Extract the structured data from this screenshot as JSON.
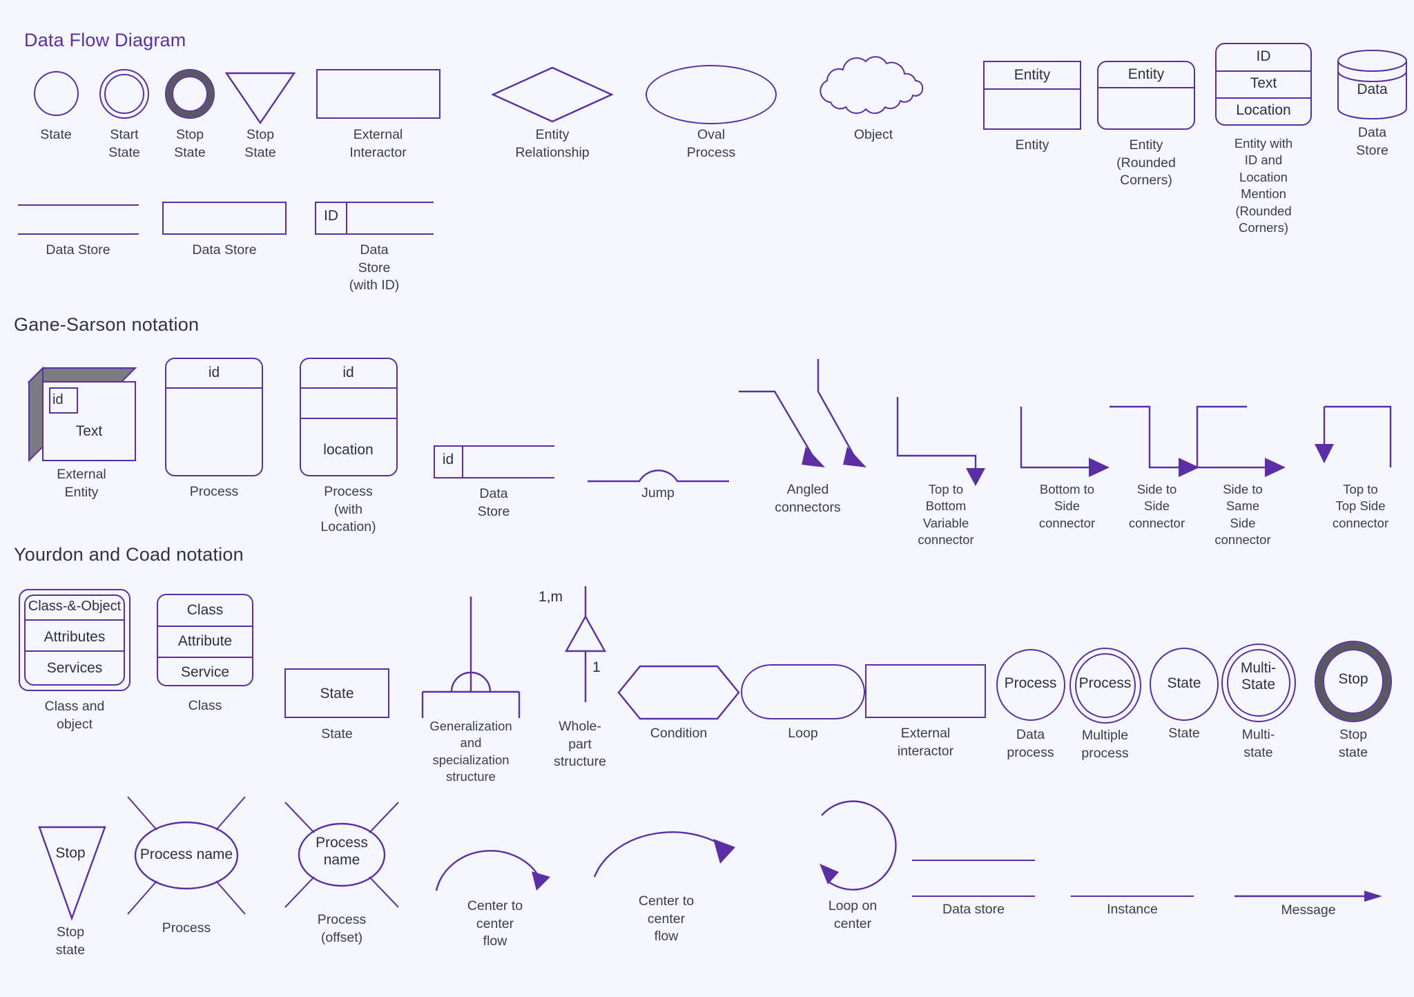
{
  "page": {
    "background": "#f4f8fe",
    "accent": "#5b2ea6",
    "ring_grey": "#58585f",
    "text_color": "#3c3c47"
  },
  "sections": [
    {
      "id": "dfd",
      "title": "Data Flow Diagram"
    },
    {
      "id": "gane",
      "title": "Gane-Sarson notation"
    },
    {
      "id": "yourdon",
      "title": "Yourdon and Coad notation"
    }
  ],
  "dfd": {
    "row1": [
      {
        "caption": "State",
        "shape": "circle"
      },
      {
        "caption": "Start State",
        "shape": "double-circle"
      },
      {
        "caption": "Stop State",
        "shape": "thick-ring-circle"
      },
      {
        "caption": "Stop State",
        "shape": "down-triangle"
      },
      {
        "caption": "External Interactor",
        "shape": "rectangle"
      },
      {
        "caption": "Entity Relationship",
        "shape": "diamond"
      },
      {
        "caption": "Oval Process",
        "shape": "oval"
      },
      {
        "caption": "Object",
        "shape": "cloud"
      },
      {
        "caption": "Entity",
        "shape": "entity-box",
        "cells": [
          "Entity"
        ]
      },
      {
        "caption": "Entity\n(Rounded Corners)",
        "shape": "entity-box-rounded",
        "cells": [
          "Entity"
        ]
      },
      {
        "caption": "Entity with ID and\nLocation Mention\n(Rounded Corners)",
        "shape": "entity-three-rounded",
        "cells": [
          "ID",
          "Text",
          "Location"
        ]
      },
      {
        "caption": "Data Store",
        "shape": "cylinder",
        "cells": [
          "Data"
        ]
      }
    ],
    "row2": [
      {
        "caption": "Data Store",
        "shape": "open-store"
      },
      {
        "caption": "Data Store",
        "shape": "closed-store"
      },
      {
        "caption": "Data Store (with ID)",
        "shape": "store-with-id",
        "cells": [
          "ID"
        ]
      }
    ]
  },
  "gane": {
    "items": [
      {
        "caption": "External Entity",
        "shape": "3d-box",
        "cells": [
          "id",
          "Text"
        ]
      },
      {
        "caption": "Process",
        "shape": "process-2",
        "cells": [
          "id"
        ]
      },
      {
        "caption": "Process\n(with Location)",
        "shape": "process-3",
        "cells": [
          "id",
          "",
          "location"
        ]
      },
      {
        "caption": "Data Store",
        "shape": "gane-store",
        "cells": [
          "id"
        ]
      },
      {
        "caption": "Jump",
        "shape": "jump"
      },
      {
        "caption": "Angled connectors",
        "shape": "angled-connectors"
      },
      {
        "caption": "Top to Bottom\nVariable\nconnector",
        "shape": "top-bottom-variable"
      },
      {
        "caption": "Bottom to Side\nconnector",
        "shape": "bottom-to-side"
      },
      {
        "caption": "Side to Side\nconnector",
        "shape": "side-to-side"
      },
      {
        "caption": "Side to Same\nSide connector",
        "shape": "side-to-same-side"
      },
      {
        "caption": "Top to Top Side\nconnector",
        "shape": "top-to-top-side"
      }
    ]
  },
  "yourdon": {
    "row1": [
      {
        "caption": "Class and object",
        "shape": "class-and-object",
        "cells": [
          "Class-&-Object",
          "Attributes",
          "Services"
        ]
      },
      {
        "caption": "Class",
        "shape": "class",
        "cells": [
          "Class",
          "Attribute",
          "Service"
        ]
      },
      {
        "caption": "State",
        "shape": "state-rect",
        "cells": [
          "State"
        ]
      },
      {
        "caption": "Generalization\nand specialization\nstructure",
        "shape": "generalization"
      },
      {
        "caption": "Whole-part\nstructure",
        "shape": "whole-part",
        "labels": [
          "1,m",
          "1"
        ]
      },
      {
        "caption": "Condition",
        "shape": "hexagon"
      },
      {
        "caption": "Loop",
        "shape": "loop-shape"
      },
      {
        "caption": "External\ninteractor",
        "shape": "rectangle"
      },
      {
        "caption": "Data process",
        "shape": "circle-label",
        "cells": [
          "Process"
        ]
      },
      {
        "caption": "Multiple\nprocess",
        "shape": "double-circle-label",
        "cells": [
          "Process"
        ]
      },
      {
        "caption": "State",
        "shape": "circle-label",
        "cells": [
          "State"
        ]
      },
      {
        "caption": "Multi-state",
        "shape": "double-circle-label",
        "cells": [
          "Multi-\nState"
        ]
      },
      {
        "caption": "Stop state",
        "shape": "thick-ring-label",
        "cells": [
          "Stop"
        ]
      }
    ],
    "row2": [
      {
        "caption": "Stop state",
        "shape": "triangle-label",
        "cells": [
          "Stop"
        ]
      },
      {
        "caption": "Process",
        "shape": "process-rays",
        "cells": [
          "Process name"
        ]
      },
      {
        "caption": "Process (offset)",
        "shape": "process-rays-offset",
        "cells": [
          "Process\nname"
        ]
      },
      {
        "caption": "Center to center\nflow",
        "shape": "arc-small"
      },
      {
        "caption": "Center to center\nflow",
        "shape": "arc-large"
      },
      {
        "caption": "Loop on center",
        "shape": "loop-on-center"
      },
      {
        "caption": "Data store",
        "shape": "two-lines"
      },
      {
        "caption": "Instance",
        "shape": "single-line"
      },
      {
        "caption": "Message",
        "shape": "line-arrow"
      }
    ]
  }
}
